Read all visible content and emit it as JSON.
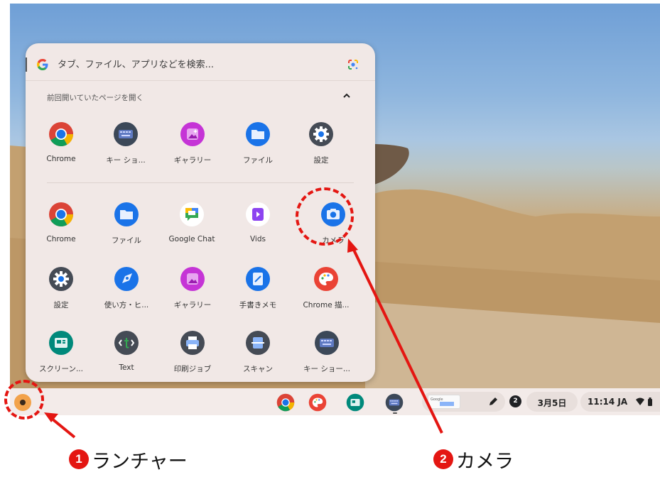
{
  "search": {
    "placeholder": "タブ、ファイル、アプリなどを検索..."
  },
  "recent_section": {
    "label": "前回開いていたページを開く",
    "collapse_icon": "chevron-up-icon"
  },
  "recent_apps": [
    {
      "label": "Chrome",
      "icon": "chrome-icon"
    },
    {
      "label": "キー ショ...",
      "icon": "keyboard-shortcuts-icon"
    },
    {
      "label": "ギャラリー",
      "icon": "gallery-icon"
    },
    {
      "label": "ファイル",
      "icon": "files-icon"
    },
    {
      "label": "設定",
      "icon": "settings-icon"
    }
  ],
  "apps": [
    {
      "label": "Chrome",
      "icon": "chrome-icon"
    },
    {
      "label": "ファイル",
      "icon": "files-icon"
    },
    {
      "label": "Google Chat",
      "icon": "google-chat-icon"
    },
    {
      "label": "Vids",
      "icon": "vids-icon"
    },
    {
      "label": "カメラ",
      "icon": "camera-icon"
    },
    {
      "label": "設定",
      "icon": "settings-icon"
    },
    {
      "label": "使い方・ヒ...",
      "icon": "explore-icon"
    },
    {
      "label": "ギャラリー",
      "icon": "gallery-icon"
    },
    {
      "label": "手書きメモ",
      "icon": "cursive-icon"
    },
    {
      "label": "Chrome 描...",
      "icon": "chrome-canvas-icon"
    },
    {
      "label": "スクリーン...",
      "icon": "screencast-icon"
    },
    {
      "label": "Text",
      "icon": "text-icon"
    },
    {
      "label": "印刷ジョブ",
      "icon": "print-jobs-icon"
    },
    {
      "label": "スキャン",
      "icon": "scan-icon"
    },
    {
      "label": "キー ショー...",
      "icon": "keyboard-shortcuts-icon"
    }
  ],
  "shelf": {
    "pinned_apps": [
      "chrome-icon",
      "chrome-canvas-icon",
      "screencast-icon",
      "keyboard-shortcuts-icon"
    ],
    "tote_thumbnail_text": "Google",
    "notification_count": "2",
    "date": "3月5日",
    "time": "11:14 JA"
  },
  "annotations": [
    {
      "number": "1",
      "label": "ランチャー"
    },
    {
      "number": "2",
      "label": "カメラ"
    }
  ],
  "colors": {
    "annotation_red": "#e41612",
    "launcher_bg": "#f1e8e6",
    "google_blue": "#1a73e8"
  }
}
